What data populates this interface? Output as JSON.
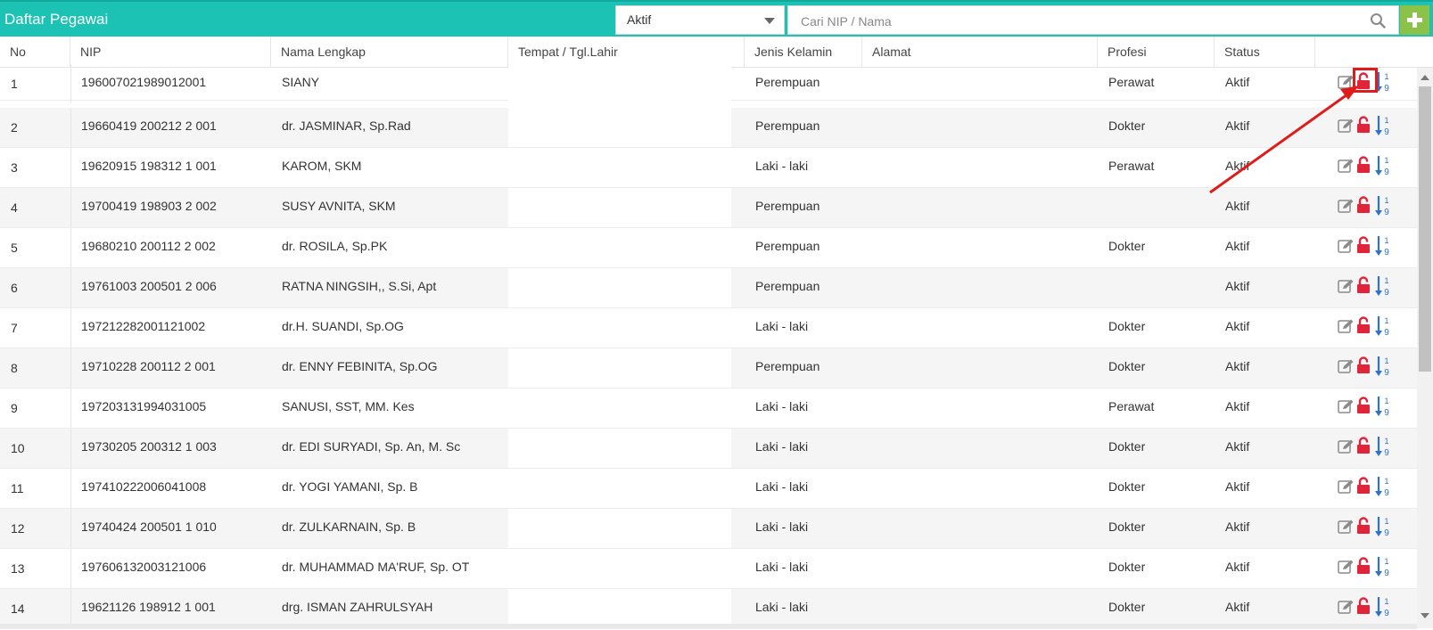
{
  "header": {
    "title": "Daftar Pegawai",
    "status_filter": "Aktif",
    "search_placeholder": "Cari NIP / Nama",
    "accent_color": "#1cc3b5",
    "add_button_color": "#8bc34a"
  },
  "columns": [
    "No",
    "NIP",
    "Nama Lengkap",
    "Tempat / Tgl.Lahir",
    "Jenis Kelamin",
    "Alamat",
    "Profesi",
    "Status"
  ],
  "rows": [
    {
      "no": "1",
      "nip": "196007021989012001",
      "nama": "SIANY",
      "ttl": "",
      "jk": "Perempuan",
      "alamat": "",
      "profesi": "Perawat",
      "status": "Aktif"
    },
    {
      "no": "2",
      "nip": "19660419 200212 2 001",
      "nama": "dr. JASMINAR, Sp.Rad",
      "ttl": "",
      "jk": "Perempuan",
      "alamat": "",
      "profesi": "Dokter",
      "status": "Aktif"
    },
    {
      "no": "3",
      "nip": "19620915 198312 1 001",
      "nama": "KAROM, SKM",
      "ttl": "",
      "jk": "Laki - laki",
      "alamat": "",
      "profesi": "Perawat",
      "status": "Aktif"
    },
    {
      "no": "4",
      "nip": "19700419 198903 2 002",
      "nama": "SUSY AVNITA, SKM",
      "ttl": "",
      "jk": "Perempuan",
      "alamat": "",
      "profesi": "",
      "status": "Aktif"
    },
    {
      "no": "5",
      "nip": "19680210 200112 2 002",
      "nama": "dr. ROSILA, Sp.PK",
      "ttl": "",
      "jk": "Perempuan",
      "alamat": "",
      "profesi": "Dokter",
      "status": "Aktif"
    },
    {
      "no": "6",
      "nip": "19761003 200501 2 006",
      "nama": "RATNA NINGSIH,, S.Si, Apt",
      "ttl": "",
      "jk": "Perempuan",
      "alamat": "",
      "profesi": "",
      "status": "Aktif"
    },
    {
      "no": "7",
      "nip": "197212282001121002",
      "nama": "dr.H. SUANDI, Sp.OG",
      "ttl": "",
      "jk": "Laki - laki",
      "alamat": "",
      "profesi": "Dokter",
      "status": "Aktif"
    },
    {
      "no": "8",
      "nip": "19710228 200112 2 001",
      "nama": "dr. ENNY FEBINITA, Sp.OG",
      "ttl": "",
      "jk": "Perempuan",
      "alamat": "",
      "profesi": "Dokter",
      "status": "Aktif"
    },
    {
      "no": "9",
      "nip": "197203131994031005",
      "nama": "SANUSI, SST, MM. Kes",
      "ttl": "",
      "jk": "Laki - laki",
      "alamat": "",
      "profesi": "Perawat",
      "status": "Aktif"
    },
    {
      "no": "10",
      "nip": "19730205 200312 1 003",
      "nama": "dr. EDI SURYADI, Sp. An, M. Sc",
      "ttl": "",
      "jk": "Laki - laki",
      "alamat": "",
      "profesi": "Dokter",
      "status": "Aktif"
    },
    {
      "no": "11",
      "nip": "197410222006041008",
      "nama": "dr. YOGI YAMANI, Sp. B",
      "ttl": "",
      "jk": "Laki - laki",
      "alamat": "",
      "profesi": "Dokter",
      "status": "Aktif"
    },
    {
      "no": "12",
      "nip": "19740424 200501 1 010",
      "nama": "dr. ZULKARNAIN, Sp. B",
      "ttl": "",
      "jk": "Laki - laki",
      "alamat": "",
      "profesi": "Dokter",
      "status": "Aktif"
    },
    {
      "no": "13",
      "nip": "197606132003121006",
      "nama": "dr. MUHAMMAD MA'RUF, Sp. OT",
      "ttl": "",
      "jk": "Laki - laki",
      "alamat": "",
      "profesi": "Dokter",
      "status": "Aktif"
    },
    {
      "no": "14",
      "nip": "19621126 198912 1 001",
      "nama": "drg. ISMAN ZAHRULSYAH",
      "ttl": "",
      "jk": "Laki - laki",
      "alamat": "",
      "profesi": "Dokter",
      "status": "Aktif"
    }
  ],
  "row_actions": {
    "icons": [
      "edit-icon",
      "unlock-icon",
      "sort-numeric-icon"
    ],
    "sort_digits": [
      "1",
      "9"
    ],
    "highlighted_row": 1,
    "highlight_color": "#e01b1b"
  }
}
